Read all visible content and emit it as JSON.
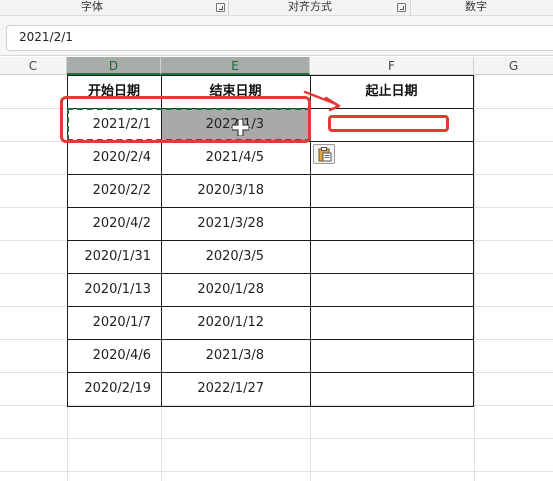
{
  "ribbon": {
    "groups": [
      {
        "label": "字体"
      },
      {
        "label": "对齐方式"
      },
      {
        "label": "数字"
      }
    ]
  },
  "formula_bar": {
    "value": "2021/2/1"
  },
  "columns": {
    "headers": [
      "C",
      "D",
      "E",
      "F",
      "G"
    ],
    "selected": [
      "D",
      "E"
    ]
  },
  "table": {
    "headers": {
      "D": "开始日期",
      "E": "结束日期",
      "F": "起止日期"
    },
    "rows": [
      {
        "start": "2021/2/1",
        "end": "2022/1/3",
        "range": ""
      },
      {
        "start": "2020/2/4",
        "end": "2021/4/5",
        "range": ""
      },
      {
        "start": "2020/2/2",
        "end": "2020/3/18",
        "range": ""
      },
      {
        "start": "2020/4/2",
        "end": "2021/3/28",
        "range": ""
      },
      {
        "start": "2020/1/31",
        "end": "2020/3/5",
        "range": ""
      },
      {
        "start": "2020/1/13",
        "end": "2020/1/28",
        "range": ""
      },
      {
        "start": "2020/1/7",
        "end": "2020/1/12",
        "range": ""
      },
      {
        "start": "2020/4/6",
        "end": "2021/3/8",
        "range": ""
      },
      {
        "start": "2020/2/19",
        "end": "2022/1/27",
        "range": ""
      }
    ]
  },
  "annotation": {
    "color": "#e53935"
  },
  "selection": {
    "color": "#a9a9a9",
    "marquee_color": "#1f6f3d"
  },
  "icons": {
    "paste_options": "paste-options-icon",
    "cursor": "cell-cross-cursor-icon",
    "launcher": "dialog-launcher-icon"
  }
}
